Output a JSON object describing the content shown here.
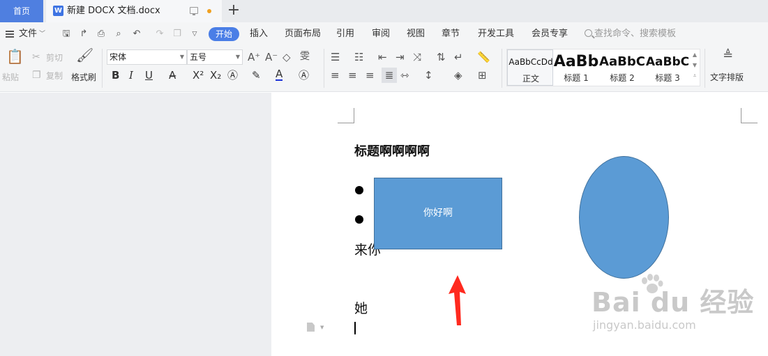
{
  "tabs": {
    "home": "首页",
    "document_icon": "W",
    "document": "新建 DOCX 文档.docx",
    "new_tab": "+"
  },
  "menu": {
    "file": "文件",
    "items": [
      "开始",
      "插入",
      "页面布局",
      "引用",
      "审阅",
      "视图",
      "章节",
      "开发工具",
      "会员专享"
    ],
    "search_placeholder": "查找命令、搜索模板"
  },
  "ribbon": {
    "paste": "粘贴",
    "cut": "剪切",
    "copy": "复制",
    "format_painter": "格式刷",
    "font": "宋体",
    "font_size": "五号",
    "text_layout": "文字排版",
    "styles": [
      {
        "sample": "AaBbCcDd",
        "label": "正文"
      },
      {
        "sample": "AaBb",
        "label": "标题 1"
      },
      {
        "sample": "AaBbC",
        "label": "标题 2"
      },
      {
        "sample": "AaBbC",
        "label": "标题 3"
      }
    ]
  },
  "document": {
    "title": "标题啊啊啊啊",
    "rect_text": "你好啊",
    "line1": "来你",
    "line2": "她"
  },
  "watermark": {
    "brand": "Bai du 经验",
    "url": "jingyan.baidu.com"
  },
  "colors": {
    "accent": "#4a7ee6",
    "shape_fill": "#5b9bd5",
    "shape_border": "#41719c",
    "annotation_arrow": "#ff2a1f"
  }
}
